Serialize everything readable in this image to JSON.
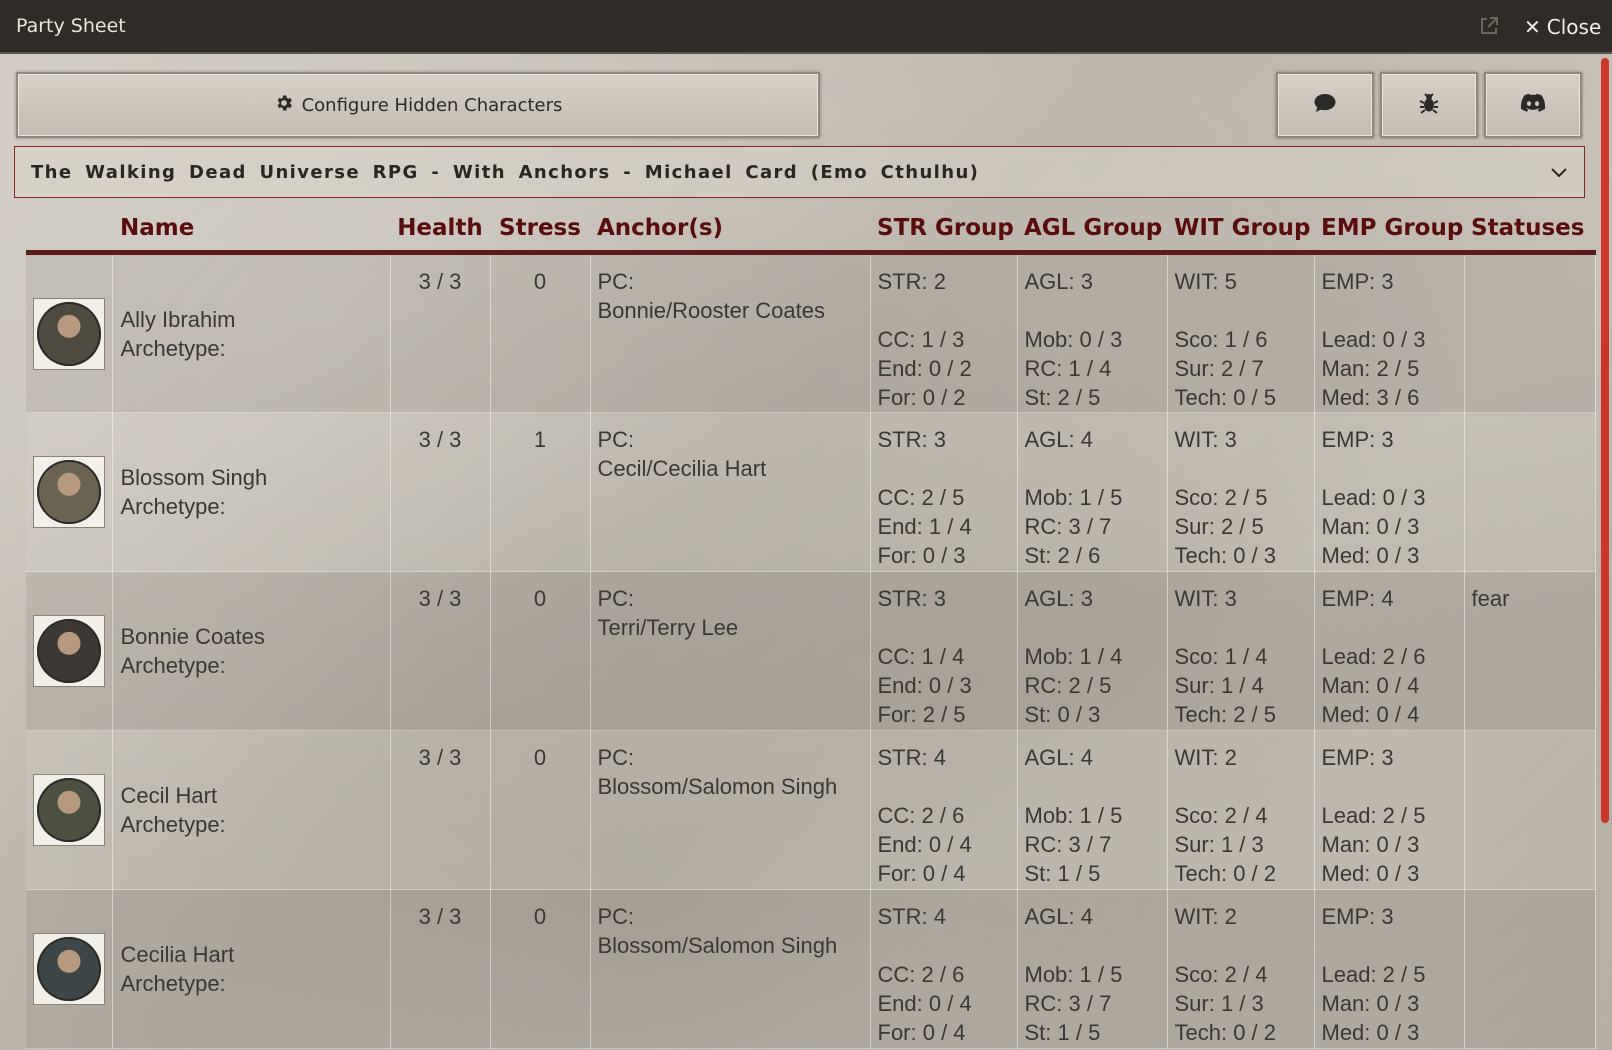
{
  "window": {
    "title": "Party Sheet",
    "close_label": "Close"
  },
  "toolbar": {
    "configure_label": "Configure Hidden Characters"
  },
  "system_select": {
    "value": "The Walking Dead Universe RPG - With Anchors - Michael Card (Emo Cthulhu)"
  },
  "table": {
    "headers": {
      "name": "Name",
      "health": "Health",
      "stress": "Stress",
      "anchors": "Anchor(s)",
      "str": "STR Group",
      "agl": "AGL Group",
      "wit": "WIT Group",
      "emp": "EMP Group",
      "statuses": "Statuses"
    },
    "rows": [
      {
        "name": "Ally Ibrahim",
        "archetype": "Archetype:",
        "health": "3 / 3",
        "stress": "0",
        "anchor_label": "PC:",
        "anchor": "Bonnie/Rooster Coates",
        "str": [
          "STR: 2",
          "CC: 1 / 3",
          "End: 0 / 2",
          "For: 0 / 2"
        ],
        "agl": [
          "AGL: 3",
          "Mob: 0 / 3",
          "RC: 1 / 4",
          "St: 2 / 5"
        ],
        "wit": [
          "WIT: 5",
          "Sco: 1 / 6",
          "Sur: 2 / 7",
          "Tech: 0 / 5"
        ],
        "emp": [
          "EMP: 3",
          "Lead: 0 / 3",
          "Man: 2 / 5",
          "Med: 3 / 6"
        ],
        "statuses": "",
        "avatar_color": "#4f4a3f"
      },
      {
        "name": "Blossom Singh",
        "archetype": "Archetype:",
        "health": "3 / 3",
        "stress": "1",
        "anchor_label": "PC:",
        "anchor": "Cecil/Cecilia Hart",
        "str": [
          "STR: 3",
          "CC: 2 / 5",
          "End: 1 / 4",
          "For: 0 / 3"
        ],
        "agl": [
          "AGL: 4",
          "Mob: 1 / 5",
          "RC: 3 / 7",
          "St: 2 / 6"
        ],
        "wit": [
          "WIT: 3",
          "Sco: 2 / 5",
          "Sur: 2 / 5",
          "Tech: 0 / 3"
        ],
        "emp": [
          "EMP: 3",
          "Lead: 0 / 3",
          "Man: 0 / 3",
          "Med: 0 / 3"
        ],
        "statuses": "",
        "avatar_color": "#6c6452"
      },
      {
        "name": "Bonnie Coates",
        "archetype": "Archetype:",
        "health": "3 / 3",
        "stress": "0",
        "anchor_label": "PC:",
        "anchor": "Terri/Terry Lee",
        "str": [
          "STR: 3",
          "CC: 1 / 4",
          "End: 0 / 3",
          "For: 2 / 5"
        ],
        "agl": [
          "AGL: 3",
          "Mob: 1 / 4",
          "RC: 2 / 5",
          "St: 0 / 3"
        ],
        "wit": [
          "WIT: 3",
          "Sco: 1 / 4",
          "Sur: 1 / 4",
          "Tech: 2 / 5"
        ],
        "emp": [
          "EMP: 4",
          "Lead: 2 / 6",
          "Man: 0 / 4",
          "Med: 0 / 4"
        ],
        "statuses": "fear",
        "avatar_color": "#3d3833"
      },
      {
        "name": "Cecil Hart",
        "archetype": "Archetype:",
        "health": "3 / 3",
        "stress": "0",
        "anchor_label": "PC:",
        "anchor": "Blossom/Salomon Singh",
        "str": [
          "STR: 4",
          "CC: 2 / 6",
          "End: 0 / 4",
          "For: 0 / 4"
        ],
        "agl": [
          "AGL: 4",
          "Mob: 1 / 5",
          "RC: 3 / 7",
          "St: 1 / 5"
        ],
        "wit": [
          "WIT: 2",
          "Sco: 2 / 4",
          "Sur: 1 / 3",
          "Tech: 0 / 2"
        ],
        "emp": [
          "EMP: 3",
          "Lead: 2 / 5",
          "Man: 0 / 3",
          "Med: 0 / 3"
        ],
        "statuses": "",
        "avatar_color": "#4b5040"
      },
      {
        "name": "Cecilia Hart",
        "archetype": "Archetype:",
        "health": "3 / 3",
        "stress": "0",
        "anchor_label": "PC:",
        "anchor": "Blossom/Salomon Singh",
        "str": [
          "STR: 4",
          "CC: 2 / 6",
          "End: 0 / 4",
          "For: 0 / 4"
        ],
        "agl": [
          "AGL: 4",
          "Mob: 1 / 5",
          "RC: 3 / 7",
          "St: 1 / 5"
        ],
        "wit": [
          "WIT: 2",
          "Sco: 2 / 4",
          "Sur: 1 / 3",
          "Tech: 0 / 2"
        ],
        "emp": [
          "EMP: 3",
          "Lead: 2 / 5",
          "Man: 0 / 3",
          "Med: 0 / 3"
        ],
        "statuses": "",
        "avatar_color": "#3f4648"
      }
    ]
  },
  "icons": {
    "configure": "gear-icon",
    "chat": "chat-bubble-icon",
    "bug": "bug-icon",
    "discord": "discord-icon",
    "popout": "popout-icon",
    "close": "close-icon",
    "dropdown": "chevron-down-icon"
  },
  "colors": {
    "header_text": "#5a0d0d",
    "header_rule": "#5b1c1c",
    "scrollbar": "#c9372c",
    "select_border": "#8a1f1f"
  }
}
